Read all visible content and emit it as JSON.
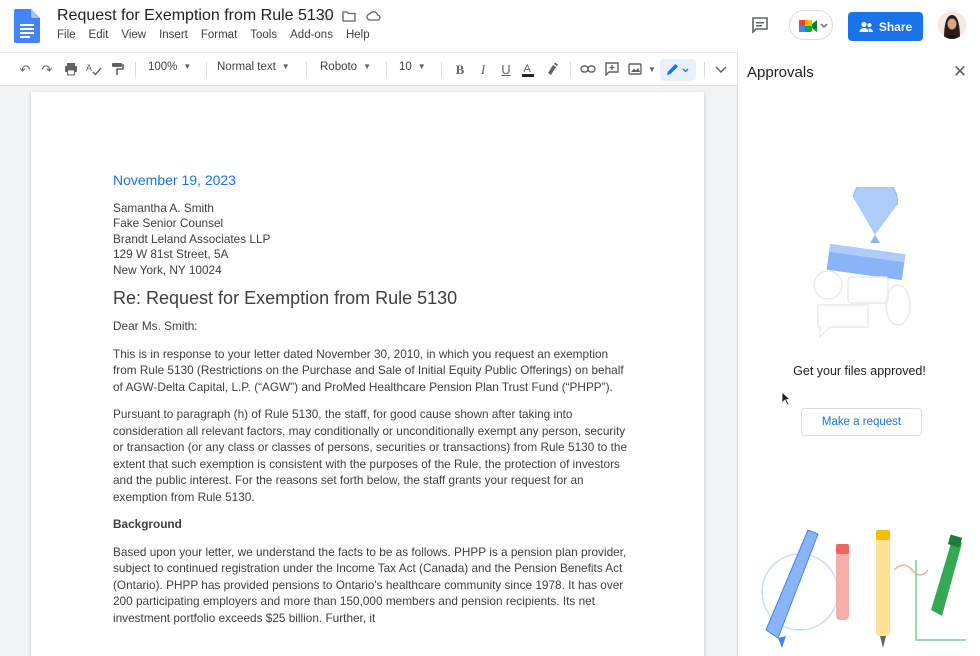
{
  "app": {
    "title": "Request for Exemption from Rule 5130",
    "menu": [
      "File",
      "Edit",
      "View",
      "Insert",
      "Format",
      "Tools",
      "Add-ons",
      "Help"
    ],
    "share_label": "Share"
  },
  "toolbar": {
    "zoom": "100%",
    "style": "Normal text",
    "font": "Roboto",
    "size": "10"
  },
  "document": {
    "date": "November 19, 2023",
    "address": [
      "Samantha A. Smith",
      "Fake Senior Counsel",
      "Brandt Leland Associates LLP",
      "129 W 81st Street, 5A",
      "New York, NY 10024"
    ],
    "re": "Re: Request for Exemption from Rule 5130",
    "salutation": "Dear Ms. Smith:",
    "para1": "This is in response to your letter dated November 30, 2010, in which you request an exemption from Rule 5130 (Restrictions on the Purchase and Sale of Initial Equity Public Offerings) on behalf of AGW-Delta Capital, L.P. (“AGW”) and ProMed Healthcare Pension Plan Trust Fund (“PHPP”).",
    "para2": "Pursuant to paragraph (h) of Rule 5130, the staff, for good cause shown after taking into consideration all relevant factors, may conditionally or unconditionally exempt any person, security or transaction (or any class or classes of persons, securities or transactions) from Rule 5130 to the extent that such exemption is consistent with the purposes of the Rule, the protection of investors and the public interest. For the reasons set forth below, the staff grants your request for an exemption from Rule 5130.",
    "heading": "Background",
    "para3": "Based upon your letter, we understand the facts to be as follows. PHPP is a pension plan provider, subject to continued registration under the Income Tax Act (Canada) and the Pension Benefits Act (Ontario). PHPP has provided pensions to Ontario's healthcare community since 1978. It has over 200 participating employers and more than 150,000 members and pension recipients. Its net investment portfolio exceeds $25 billion. Further, it"
  },
  "panel": {
    "title": "Approvals",
    "message": "Get your files approved!",
    "button": "Make a request"
  },
  "colors": {
    "accent": "#1a73e8",
    "docs_blue": "#4285f4"
  }
}
